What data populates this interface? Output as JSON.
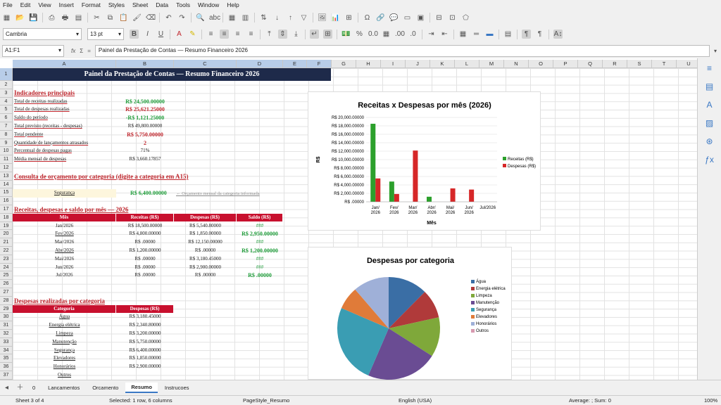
{
  "menu": [
    "File",
    "Edit",
    "View",
    "Insert",
    "Format",
    "Styles",
    "Sheet",
    "Data",
    "Tools",
    "Window",
    "Help"
  ],
  "toolbar": {
    "font_name": "Cambria",
    "font_size": "13 pt"
  },
  "formula": {
    "cell_ref": "A1:F1",
    "fx": "fx",
    "sigma": "Σ",
    "eq": "=",
    "content": "Painel da Prestação de Contas — Resumo Financeiro 2026"
  },
  "columns": [
    "A",
    "B",
    "C",
    "D",
    "E",
    "F",
    "G",
    "H",
    "I",
    "J",
    "K",
    "L",
    "M",
    "N",
    "O",
    "P",
    "Q",
    "R",
    "S",
    "T",
    "U"
  ],
  "rows": [
    "1",
    "2",
    "3",
    "4",
    "5",
    "6",
    "7",
    "8",
    "9",
    "10",
    "11",
    "12",
    "13",
    "14",
    "15",
    "16",
    "17",
    "18",
    "19",
    "20",
    "21",
    "22",
    "23",
    "24",
    "25",
    "26",
    "27",
    "28",
    "29",
    "30",
    "31",
    "32",
    "33",
    "34",
    "35",
    "36",
    "37"
  ],
  "title": "Painel da Prestação de Contas — Resumo Financeiro 2026",
  "kpi": {
    "header": "Indicadores principais",
    "rows": [
      {
        "label": "Total de receitas realizadas",
        "value": "R$ 24,500.00000",
        "style": "grn"
      },
      {
        "label": "Total de despesas realizadas",
        "value": "R$ 25,621.25000",
        "style": "red"
      },
      {
        "label": "Saldo do período",
        "value": "-R$ 1,121.25000",
        "style": "grn"
      },
      {
        "label": "Total previsto (receitas - despesas)",
        "value": "R$ 49,800.00000",
        "style": "plain"
      },
      {
        "label": "Total pendente",
        "value": "R$ 5,750.00000",
        "style": "red"
      },
      {
        "label": "Quantidade de lançamentos atrasados",
        "value": "2",
        "style": "red"
      },
      {
        "label": "Percentual de despesas pagas",
        "value": "71%",
        "style": "plain"
      },
      {
        "label": "Média mensal de despesas",
        "value": "R$ 3,660.17857",
        "style": "plain"
      }
    ]
  },
  "consulta": {
    "header": "Consulta de orçamento por categoria (digite a categoria em A15)",
    "category": "Segurança",
    "value": "R$ 6,400.00000",
    "note": "← Orçamento mensal da categoria informada"
  },
  "monthly": {
    "header": "Receitas, despesas e saldo por mês — 2026",
    "columns": [
      "Mês",
      "Receitas (R$)",
      "Despesas (R$)",
      "Saldo (R$)"
    ],
    "rows": [
      {
        "month": "Jan/2026",
        "rec": "R$ 18,500.00000",
        "desp": "R$ 5,540.80000",
        "saldo": "###",
        "saldo_style": "grn"
      },
      {
        "month": "Fev/2026",
        "rec": "R$ 4,800.00000",
        "desp": "R$ 1,850.00000",
        "saldo": "R$ 2,950.00000",
        "saldo_style": "grnbig"
      },
      {
        "month": "Mar/2026",
        "rec": "R$ .00000",
        "desp": "R$ 12,150.00000",
        "saldo": "###",
        "saldo_style": "grn"
      },
      {
        "month": "Abr/2026",
        "rec": "R$ 1,200.00000",
        "desp": "R$ .00000",
        "saldo": "R$ 1,200.00000",
        "saldo_style": "grnbig"
      },
      {
        "month": "Mai/2026",
        "rec": "R$ .00000",
        "desp": "R$ 3,180.45000",
        "saldo": "###",
        "saldo_style": "grn"
      },
      {
        "month": "Jun/2026",
        "rec": "R$ .00000",
        "desp": "R$ 2,900.00000",
        "saldo": "###",
        "saldo_style": "grn"
      },
      {
        "month": "Jul/2026",
        "rec": "R$ .00000",
        "desp": "R$ .00000",
        "saldo": "R$ .00000",
        "saldo_style": "grnbig"
      }
    ]
  },
  "categories_table": {
    "header": "Despesas realizadas por categoria",
    "columns": [
      "Categoria",
      "Despesas (R$)"
    ],
    "rows": [
      {
        "cat": "Água",
        "val": "R$ 3,180.45000"
      },
      {
        "cat": "Energia elétrica",
        "val": "R$ 2,340.80000"
      },
      {
        "cat": "Limpeza",
        "val": "R$ 3,200.00000"
      },
      {
        "cat": "Manutenção",
        "val": "R$ 5,750.00000"
      },
      {
        "cat": "Segurança",
        "val": "R$ 6,400.00000"
      },
      {
        "cat": "Elevadores",
        "val": "R$ 1,850.00000"
      },
      {
        "cat": "Honorários",
        "val": "R$ 2,900.00000"
      },
      {
        "cat": "Outros",
        "val": ""
      }
    ]
  },
  "chart_data": [
    {
      "type": "bar",
      "title": "Receitas x Despesas por mês (2026)",
      "xlabel": "Mês",
      "ylabel": "R$",
      "ylim": [
        0,
        20000
      ],
      "yticks": [
        "R$ .00000",
        "R$ 2,000.00000",
        "R$ 4,000.00000",
        "R$ 6,000.00000",
        "R$ 8,000.00000",
        "R$ 10,000.00000",
        "R$ 12,000.00000",
        "R$ 14,000.00000",
        "R$ 16,000.00000",
        "R$ 18,000.00000",
        "R$ 20,000.00000"
      ],
      "categories": [
        "Jan/ 2026",
        "Fev/ 2026",
        "Mar/ 2026",
        "Abr/ 2026",
        "Mai/ 2026",
        "Jun/ 2026",
        "Jul/2026"
      ],
      "series": [
        {
          "name": "Receitas (R$)",
          "color": "#2ca02c",
          "values": [
            18500,
            4800,
            0,
            1200,
            0,
            0,
            0
          ]
        },
        {
          "name": "Despesas (R$)",
          "color": "#d62728",
          "values": [
            5540.8,
            1850,
            12150,
            0,
            3180.45,
            2900,
            0
          ]
        }
      ],
      "legend": "right",
      "grid": true
    },
    {
      "type": "pie",
      "title": "Despesas por categoria",
      "labels": [
        "Água",
        "Energia elétrica",
        "Limpeza",
        "Manutenção",
        "Segurança",
        "Elevadores",
        "Honorários",
        "Outros"
      ],
      "colors": [
        "#3a6ea5",
        "#b03a3a",
        "#7fa83a",
        "#6a4c93",
        "#3a9db3",
        "#e07b39",
        "#9fb0d8",
        "#d79ab0"
      ],
      "values": [
        3180.45,
        2340.8,
        3200,
        5750,
        6400,
        1850,
        2900,
        0
      ],
      "legend": "right"
    }
  ],
  "sheet_tabs": [
    "0",
    "Lancamentos",
    "Orcamento",
    "Resumo",
    "Instrucoes"
  ],
  "active_tab": "Resumo",
  "status": {
    "sheet": "Sheet 3 of 4",
    "selected": "Selected: 1 row, 6 columns",
    "pagestyle": "PageStyle_Resumo",
    "lang": "English (USA)",
    "avg": "Average: ; Sum: 0",
    "zoom": "100%"
  }
}
